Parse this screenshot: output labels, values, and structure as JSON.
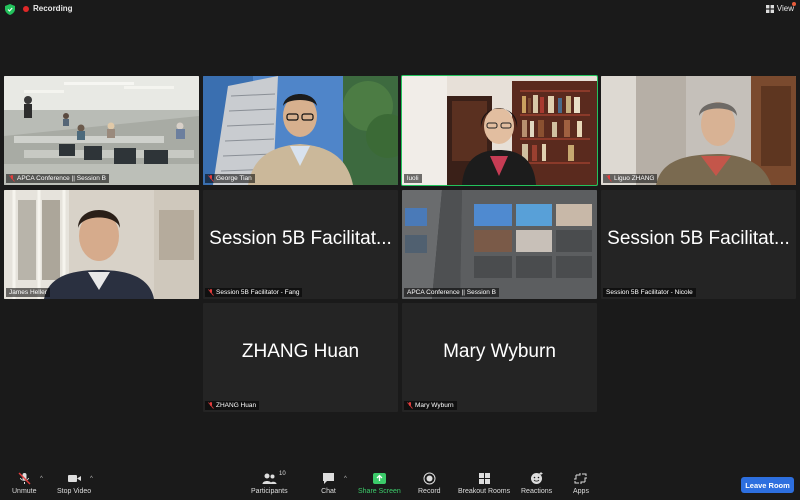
{
  "topbar": {
    "recording_label": "Recording",
    "view_label": "View"
  },
  "tiles": [
    {
      "name": "APCA Conference || Session B",
      "muted": true
    },
    {
      "name": "George Tian",
      "muted": true
    },
    {
      "name": "luoli",
      "muted": false,
      "speaking": true
    },
    {
      "name": "Liguo ZHANG",
      "muted": true
    },
    {
      "name": "James Heller",
      "muted": false
    },
    {
      "name": "Session 5B Facilitator - Fang",
      "display": "Session 5B Facilitat...",
      "muted": true
    },
    {
      "name": "APCA Conference || Session B",
      "muted": false
    },
    {
      "name": "Session 5B Facilitator - Nicole",
      "display": "Session 5B Facilitat...",
      "muted": false
    },
    {
      "name": "ZHANG Huan",
      "display": "ZHANG Huan",
      "muted": true
    },
    {
      "name": "Mary Wyburn",
      "display": "Mary Wyburn",
      "muted": true
    }
  ],
  "toolbar": {
    "unmute": "Unmute",
    "stop_video": "Stop Video",
    "participants": "Participants",
    "participants_count": "10",
    "chat": "Chat",
    "share_screen": "Share Screen",
    "record": "Record",
    "breakout_rooms": "Breakout Rooms",
    "reactions": "Reactions",
    "apps": "Apps",
    "leave_room": "Leave Room"
  },
  "colors": {
    "speaking_border": "#23c25c",
    "share_green": "#3ccb6a",
    "leave_blue": "#2d6fdf",
    "recording_red": "#e02828"
  }
}
